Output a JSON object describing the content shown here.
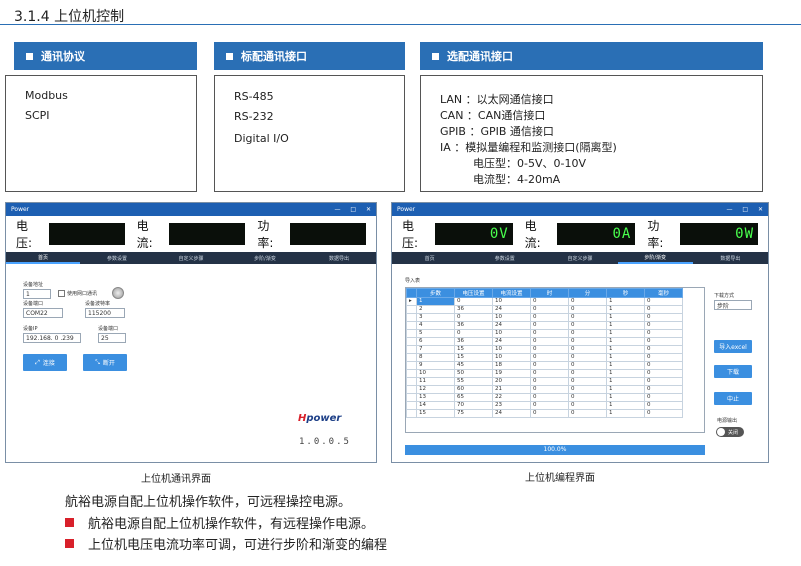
{
  "heading": "3.1.4 上位机控制",
  "sections": [
    {
      "title": "通讯协议",
      "lines": [
        "Modbus",
        "SCPI"
      ]
    },
    {
      "title": "标配通讯接口",
      "lines": [
        "RS-485",
        "RS-232",
        "Digital I/O"
      ]
    },
    {
      "title": "选配通讯接口",
      "lines": [
        "LAN ：以太网通信接口",
        "CAN ：CAN通信接口",
        "GPIB ：GPIB 通信接口",
        "IA ：模拟量编程和监测接口(隔离型)",
        "电压型：0-5V、0-10V",
        "电流型：4-20mA"
      ]
    }
  ],
  "comm_window": {
    "title": "Power",
    "buttons": [
      "—",
      "□",
      "✕"
    ],
    "readout_labels": [
      "电压:",
      "电流:",
      "功率:"
    ],
    "tabs": [
      "首页",
      "参数设置",
      "自定义步骤",
      "步阶/渐变",
      "数据导出"
    ],
    "device_label": "设备地址",
    "device_value": "1",
    "use_net_label": "使用网口通讯",
    "port_label": "设备端口",
    "port_value": "COM22",
    "baud_label": "设备波特率",
    "baud_value": "115200",
    "ip_label": "设备IP",
    "ip_value": "192.168. 0 .239",
    "netport_label": "设备端口",
    "netport_value": "25",
    "connect_label": "连接",
    "disconnect_label": "断开",
    "logo_text": "power",
    "version": "1.0.0.5"
  },
  "prog_window": {
    "title": "Power",
    "buttons": [
      "—",
      "□",
      "✕"
    ],
    "readout_labels": [
      "电压:",
      "电流:",
      "功率:"
    ],
    "readout_values": [
      "0V",
      "0A",
      "0W"
    ],
    "tabs": [
      "首页",
      "参数设置",
      "自定义步骤",
      "步阶/渐变",
      "数据导出"
    ],
    "import_label": "导入表",
    "columns": [
      "步数",
      "电压设置",
      "电流设置",
      "时",
      "分",
      "秒",
      "毫秒"
    ],
    "rows": [
      [
        "1",
        "0",
        "10",
        "0",
        "0",
        "1",
        "0"
      ],
      [
        "2",
        "36",
        "24",
        "0",
        "0",
        "1",
        "0"
      ],
      [
        "3",
        "0",
        "10",
        "0",
        "0",
        "1",
        "0"
      ],
      [
        "4",
        "36",
        "24",
        "0",
        "0",
        "1",
        "0"
      ],
      [
        "5",
        "0",
        "10",
        "0",
        "0",
        "1",
        "0"
      ],
      [
        "6",
        "36",
        "24",
        "0",
        "0",
        "1",
        "0"
      ],
      [
        "7",
        "15",
        "10",
        "0",
        "0",
        "1",
        "0"
      ],
      [
        "8",
        "15",
        "10",
        "0",
        "0",
        "1",
        "0"
      ],
      [
        "9",
        "45",
        "18",
        "0",
        "0",
        "1",
        "0"
      ],
      [
        "10",
        "50",
        "19",
        "0",
        "0",
        "1",
        "0"
      ],
      [
        "11",
        "55",
        "20",
        "0",
        "0",
        "1",
        "0"
      ],
      [
        "12",
        "60",
        "21",
        "0",
        "0",
        "1",
        "0"
      ],
      [
        "13",
        "65",
        "22",
        "0",
        "0",
        "1",
        "0"
      ],
      [
        "14",
        "70",
        "23",
        "0",
        "0",
        "1",
        "0"
      ],
      [
        "15",
        "75",
        "24",
        "0",
        "0",
        "1",
        "0"
      ]
    ],
    "scroll_value": "1",
    "download_mode_label": "下载方式",
    "download_mode_value": "步阶",
    "import_excel": "导入excel",
    "download": "下载",
    "abort": "中止",
    "output_label": "电源输出",
    "toggle_label": "关闭",
    "progress": "100.0%",
    "progress_value": 1.0
  },
  "captions": [
    "上位机通讯界面",
    "上位机编程界面"
  ],
  "body_text": "航裕电源自配上位机操作软件，可远程操控电源。",
  "bullets": [
    "航裕电源自配上位机操作软件，有远程操作电源。",
    "上位机电压电流功率可调，可进行步阶和渐变的编程"
  ],
  "colors": {
    "accent": "#2a6fb5",
    "bullet": "#d8202a",
    "lcd": "#49ff4d"
  }
}
